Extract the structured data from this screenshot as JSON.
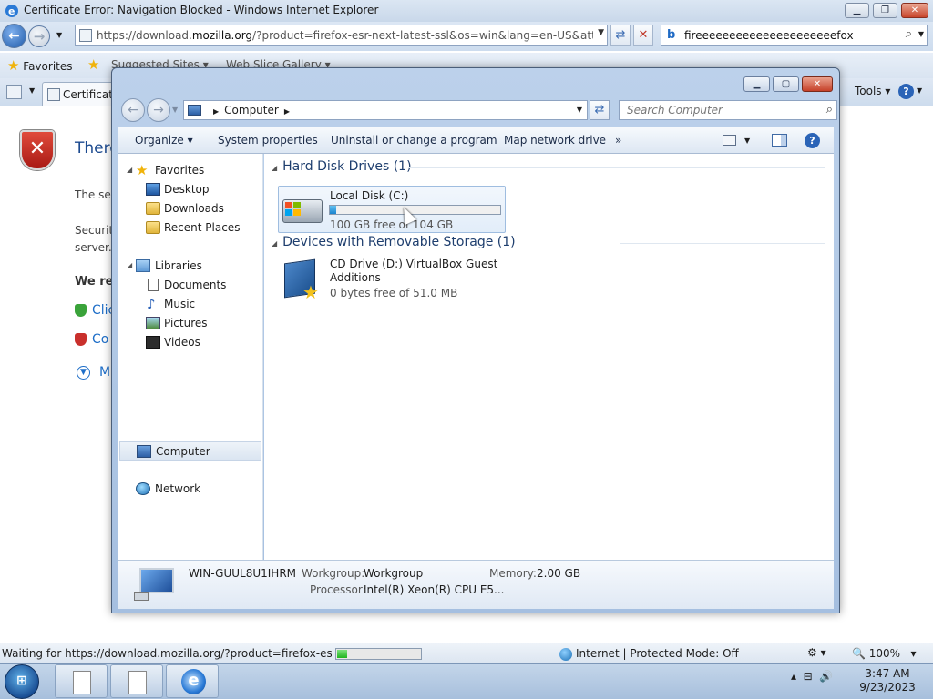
{
  "ie": {
    "title": "Certificate Error: Navigation Blocked - Windows Internet Explorer",
    "url_prefix": "https://download.",
    "url_host": "mozilla.org",
    "url_rest": "/?product=firefox-esr-next-latest-ssl&os=win&lang=en-US&attribution_c",
    "search_query": "fireeeeeeeeeeeeeeeeeeeeefox",
    "favorites_label": "Favorites",
    "suggested_sites": "Suggested Sites ▾",
    "web_slice_gallery": "Web Slice Gallery ▾",
    "tab_title": "Certificate",
    "tools_label": "Tools ▾",
    "page": {
      "heading": "There",
      "p1": "The se",
      "p2_line1": "Securit",
      "p2_line2": "server.",
      "recommend": "We re",
      "link1": "Clic",
      "link2": "Co",
      "link3": "M"
    },
    "status_text": "Waiting for https://download.mozilla.org/?product=firefox-esr-next-",
    "loading_progress": 0.12,
    "zone_text": "Internet | Protected Mode: Off",
    "zoom_text": "100%"
  },
  "explorer": {
    "breadcrumb": "Computer",
    "search_placeholder": "Search Computer",
    "toolbar": {
      "organize": "Organize ▾",
      "system_properties": "System properties",
      "uninstall": "Uninstall or change a program",
      "map_drive": "Map network drive",
      "more": "»"
    },
    "nav": {
      "favorites": "Favorites",
      "desktop": "Desktop",
      "downloads": "Downloads",
      "recent": "Recent Places",
      "libraries": "Libraries",
      "documents": "Documents",
      "music": "Music",
      "pictures": "Pictures",
      "videos": "Videos",
      "computer": "Computer",
      "network": "Network"
    },
    "groups": {
      "hdd": "Hard Disk Drives (1)",
      "removable": "Devices with Removable Storage (1)"
    },
    "local_disk": {
      "name": "Local Disk (C:)",
      "free": "100 GB free of 104 GB",
      "used_fraction": 0.04
    },
    "cd_drive": {
      "name": "CD Drive (D:) VirtualBox Guest Additions",
      "free": "0 bytes free of 51.0 MB"
    },
    "details": {
      "computer_name": "WIN-GUUL8U1IHRM",
      "workgroup_label": "Workgroup:",
      "workgroup": "Workgroup",
      "memory_label": "Memory:",
      "memory": "2.00 GB",
      "processor_label": "Processor:",
      "processor": "Intel(R) Xeon(R) CPU E5..."
    }
  },
  "taskbar": {
    "time": "3:47 AM",
    "date": "9/23/2023"
  }
}
